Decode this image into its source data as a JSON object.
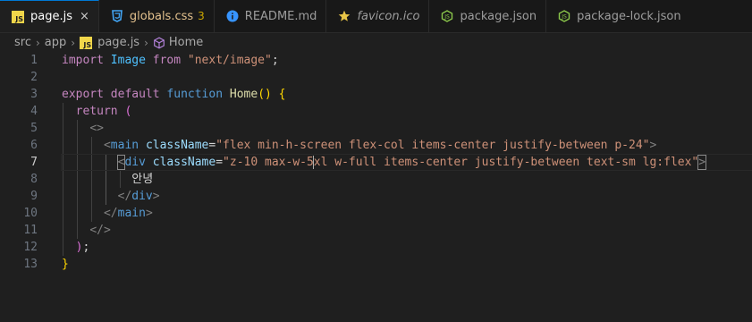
{
  "tabs": [
    {
      "label": "page.js",
      "icon": "javascript-file-icon",
      "active": true,
      "close": "×"
    },
    {
      "label": "globals.css",
      "icon": "css-file-icon",
      "badge": "3",
      "close": ""
    },
    {
      "label": "README.md",
      "icon": "info-icon",
      "close": ""
    },
    {
      "label": "favicon.ico",
      "icon": "star-icon",
      "close": ""
    },
    {
      "label": "package.json",
      "icon": "nodejs-icon",
      "close": ""
    },
    {
      "label": "package-lock.json",
      "icon": "nodejs-icon",
      "close": ""
    }
  ],
  "breadcrumb": {
    "parts": [
      "src",
      "app",
      "page.js",
      "Home"
    ]
  },
  "editor": {
    "line_numbers": [
      "1",
      "2",
      "3",
      "4",
      "5",
      "6",
      "7",
      "8",
      "9",
      "10",
      "11",
      "12",
      "13"
    ],
    "active_line": "7",
    "lines": {
      "l1": {
        "import": "import",
        "Image": "Image",
        "from": "from",
        "path": "\"next/image\"",
        "semi": ";"
      },
      "l3": {
        "export": "export",
        "default": "default",
        "function": "function",
        "name": "Home",
        "parens": "()",
        "brace": "{"
      },
      "l4": {
        "return": "return",
        "paren": "("
      },
      "l5": {
        "frag": "<>"
      },
      "l6": {
        "open": "<",
        "tag": "main",
        "attr": "className",
        "eq": "=",
        "value": "\"flex min-h-screen flex-col items-center justify-between p-24\"",
        "close": ">"
      },
      "l7": {
        "open": "<",
        "tag": "div",
        "attr": "className",
        "eq": "=",
        "value_a": "\"z-10 max-w-5",
        "value_b": "xl w-full items-center justify-between text-sm lg:flex\"",
        "close": ">"
      },
      "l8": {
        "text": "안녕"
      },
      "l9": {
        "open": "</",
        "tag": "div",
        "close": ">"
      },
      "l10": {
        "open": "</",
        "tag": "main",
        "close": ">"
      },
      "l11": {
        "frag": "</>"
      },
      "l12": {
        "paren": ")",
        "semi": ";"
      },
      "l13": {
        "brace": "}"
      }
    }
  },
  "colors": {
    "background": "#1f1f1f",
    "accent": "#0078d4",
    "keyword": "#569cd6",
    "control_keyword": "#c586c0",
    "string": "#ce9178",
    "attribute": "#9cdcfe",
    "function": "#dcdcaa",
    "class": "#4ec9b0"
  }
}
